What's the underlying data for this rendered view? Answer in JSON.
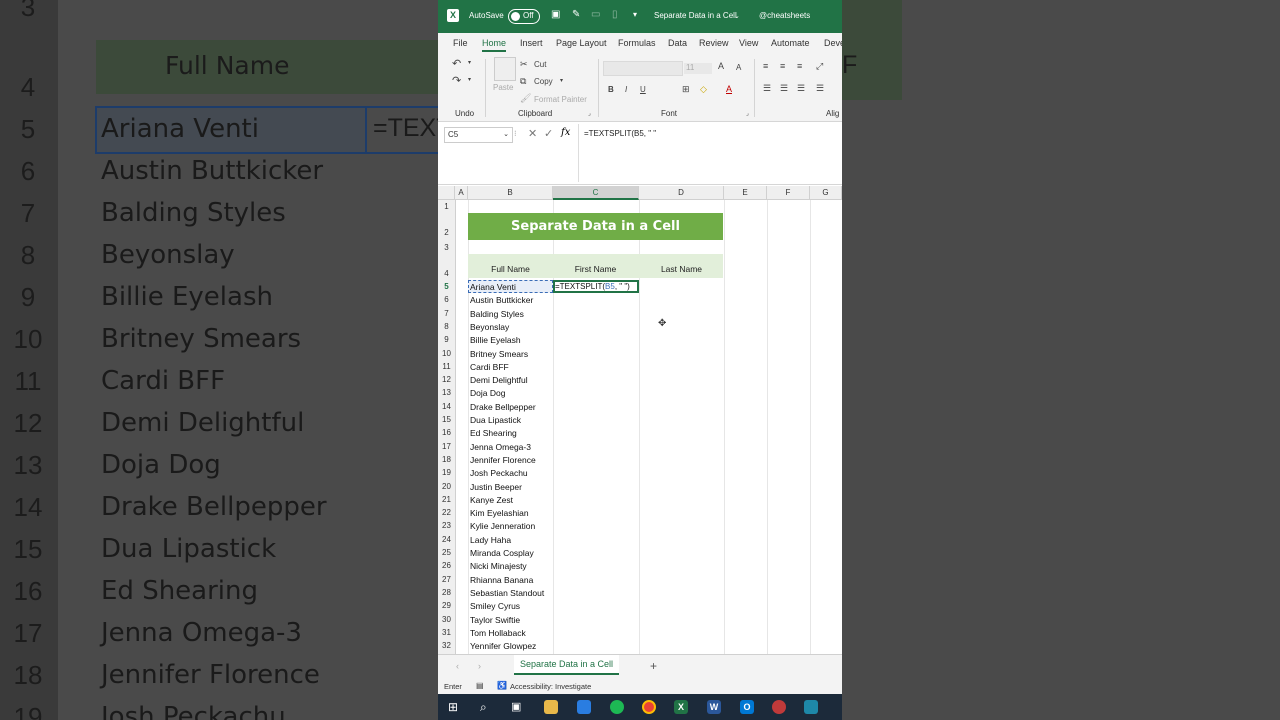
{
  "background_zoom": {
    "left": {
      "header_label": "Full Name",
      "row_numbers": [
        "3",
        "4",
        "5",
        "6",
        "7",
        "8",
        "9",
        "10",
        "11",
        "12",
        "13",
        "14",
        "15",
        "16",
        "17",
        "18",
        "19"
      ],
      "names": [
        "Ariana Venti",
        "Austin Buttkicker",
        "Balding Styles",
        "Beyonslay",
        "Billie Eyelash",
        "Britney Smears",
        "Cardi BFF",
        "Demi Delightful",
        "Doja Dog",
        "Drake Bellpepper",
        "Dua Lipastick",
        "Ed Shearing",
        "Jenna Omega-3",
        "Jennifer Florence",
        "Josh Peckachu"
      ],
      "formula_fragment": "=TEXT"
    },
    "right": {
      "corner_letter": "F"
    }
  },
  "titlebar": {
    "autosave": "AutoSave",
    "toggle": "Off",
    "filename": "Separate Data in a Cell",
    "handle": "@cheatsheets"
  },
  "menu": [
    "File",
    "Home",
    "Insert",
    "Page Layout",
    "Formulas",
    "Data",
    "Review",
    "View",
    "Automate",
    "Deve"
  ],
  "ribbon": {
    "undo_group": "Undo",
    "clipboard_group": "Clipboard",
    "font_group": "Font",
    "align_group": "Alig",
    "paste": "Paste",
    "cut": "Cut",
    "copy": "Copy",
    "format_painter": "Format Painter",
    "font_size": "11"
  },
  "formula_bar": {
    "name_box": "C5",
    "formula": "=TEXTSPLIT(B5, \" \""
  },
  "columns": [
    "A",
    "B",
    "C",
    "D",
    "E",
    "F",
    "G"
  ],
  "sheet": {
    "title": "Separate Data in a Cell",
    "headers": [
      "Full Name",
      "First Name",
      "Last Name"
    ],
    "editing_formula_prefix": "=TEXTSPLIT(",
    "editing_formula_ref": "B5",
    "editing_formula_suffix": ", \" \")",
    "rows": [
      {
        "n": "1",
        "name": ""
      },
      {
        "n": "2",
        "name": ""
      },
      {
        "n": "3",
        "name": ""
      },
      {
        "n": "4",
        "name": ""
      },
      {
        "n": "5",
        "name": "Ariana Venti"
      },
      {
        "n": "6",
        "name": "Austin Buttkicker"
      },
      {
        "n": "7",
        "name": "Balding Styles"
      },
      {
        "n": "8",
        "name": "Beyonslay"
      },
      {
        "n": "9",
        "name": "Billie Eyelash"
      },
      {
        "n": "10",
        "name": "Britney Smears"
      },
      {
        "n": "11",
        "name": "Cardi BFF"
      },
      {
        "n": "12",
        "name": "Demi Delightful"
      },
      {
        "n": "13",
        "name": "Doja Dog"
      },
      {
        "n": "14",
        "name": "Drake Bellpepper"
      },
      {
        "n": "15",
        "name": "Dua Lipastick"
      },
      {
        "n": "16",
        "name": "Ed Shearing"
      },
      {
        "n": "17",
        "name": "Jenna Omega-3"
      },
      {
        "n": "18",
        "name": "Jennifer Florence"
      },
      {
        "n": "19",
        "name": "Josh Peckachu"
      },
      {
        "n": "20",
        "name": "Justin Beeper"
      },
      {
        "n": "21",
        "name": "Kanye Zest"
      },
      {
        "n": "22",
        "name": "Kim Eyelashian"
      },
      {
        "n": "23",
        "name": "Kylie Jenneration"
      },
      {
        "n": "24",
        "name": "Lady Haha"
      },
      {
        "n": "25",
        "name": "Miranda Cosplay"
      },
      {
        "n": "26",
        "name": "Nicki Minajesty"
      },
      {
        "n": "27",
        "name": "Rhianna Banana"
      },
      {
        "n": "28",
        "name": "Sebastian Standout"
      },
      {
        "n": "29",
        "name": "Smiley Cyrus"
      },
      {
        "n": "30",
        "name": "Taylor Swiftie"
      },
      {
        "n": "31",
        "name": "Tom Hollaback"
      },
      {
        "n": "32",
        "name": "Yennifer Glowpez"
      }
    ]
  },
  "sheet_tab": "Separate Data in a Cell",
  "add_sheet": "+",
  "status": {
    "mode": "Enter",
    "accessibility": "Accessibility: Investigate"
  },
  "colors": {
    "excel_green": "#217346",
    "title_band": "#70ad47",
    "header_band": "#e2efda"
  },
  "taskbar_icons": [
    "windows-icon",
    "search-icon",
    "task-view-icon",
    "file-explorer-icon",
    "mail-icon",
    "spotify-icon",
    "chrome-icon",
    "excel-icon",
    "word-icon",
    "outlook-icon",
    "snip-icon",
    "app-icon"
  ]
}
